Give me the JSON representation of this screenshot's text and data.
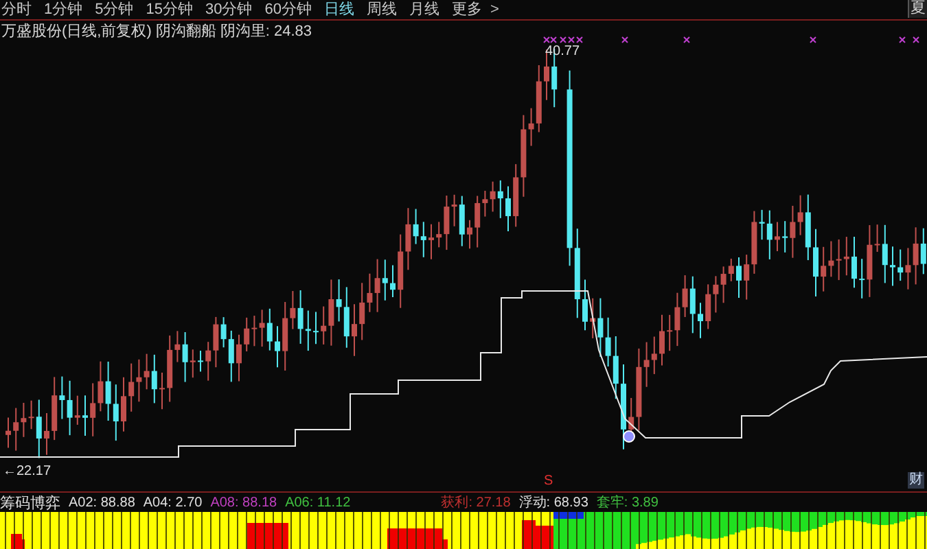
{
  "toolbar": {
    "periods": [
      {
        "label": "分时",
        "selected": false
      },
      {
        "label": "1分钟",
        "selected": false
      },
      {
        "label": "5分钟",
        "selected": false
      },
      {
        "label": "15分钟",
        "selected": false
      },
      {
        "label": "30分钟",
        "selected": false
      },
      {
        "label": "60分钟",
        "selected": false
      },
      {
        "label": "日线",
        "selected": true
      },
      {
        "label": "周线",
        "selected": false
      },
      {
        "label": "月线",
        "selected": false
      },
      {
        "label": "更多",
        "selected": false
      }
    ],
    "next": ">",
    "corner": "夏"
  },
  "chart": {
    "title": "万盛股份(日线,前复权)",
    "indicator": "阴沟翻船",
    "reading": "阴沟里: 24.83",
    "high_label": "40.77",
    "low_label": "←22.17",
    "signal": "S",
    "finance_badge": "财"
  },
  "indicator_panel": {
    "name": "筹码博弈",
    "values": [
      {
        "text": "A02: 88.88",
        "color": "#e0e0e0"
      },
      {
        "text": "A04: 2.70",
        "color": "#e0e0e0"
      },
      {
        "text": "A08: 88.18",
        "color": "#c040c0"
      },
      {
        "text": "A06: 11.12",
        "color": "#40c040"
      },
      {
        "text": "获利: 27.18",
        "color": "#c03030"
      },
      {
        "text": "浮动: 68.93",
        "color": "#e0e0e0"
      },
      {
        "text": "套牢: 3.89",
        "color": "#40c040"
      }
    ]
  }
}
